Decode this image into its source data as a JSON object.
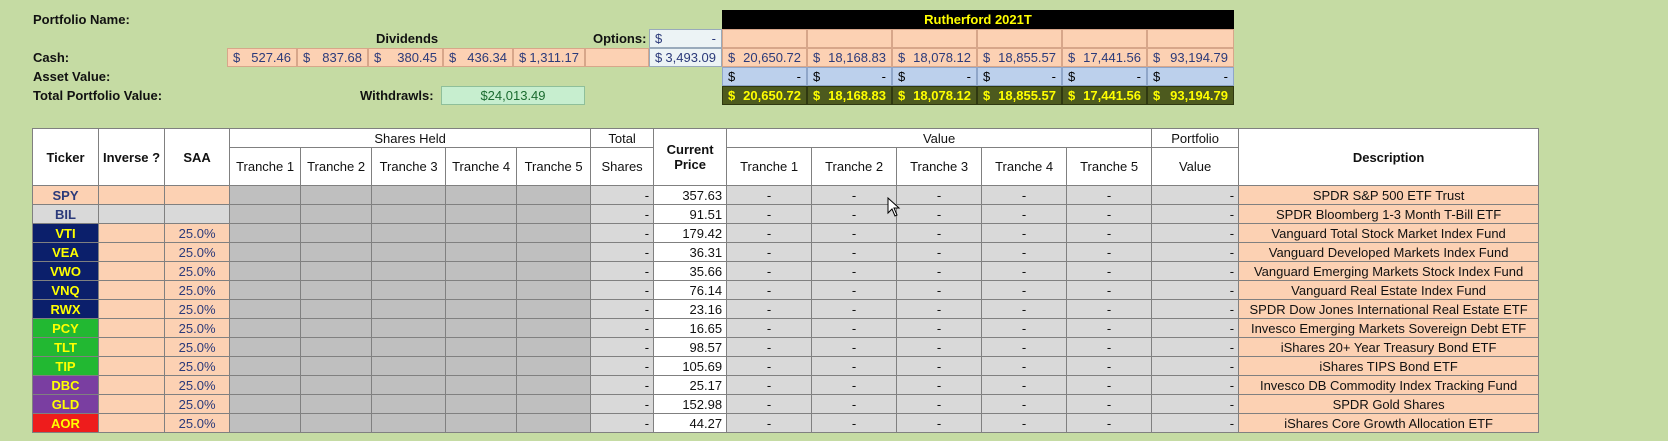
{
  "header": {
    "portfolio_name_label": "Portfolio Name:",
    "dividends_label": "Dividends",
    "options_label": "Options:",
    "cash_label": "Cash:",
    "asset_value_label": "Asset Value:",
    "total_value_label": "Total Portfolio Value:",
    "withdrawls_label": "Withdrawls:",
    "withdrawls_value": "$24,013.49",
    "dollar": "$",
    "dividends": [
      "527.46",
      "837.68",
      "380.45",
      "436.34",
      "1,311.17"
    ],
    "options_value": "-",
    "options_total": "3,493.09"
  },
  "rutherford": {
    "title": "Rutherford 2021T",
    "cash": [
      "20,650.72",
      "18,168.83",
      "18,078.12",
      "18,855.57",
      "17,441.56",
      "93,194.79"
    ],
    "asset": [
      "-",
      "-",
      "-",
      "-",
      "-",
      "-"
    ],
    "total": [
      "20,650.72",
      "18,168.83",
      "18,078.12",
      "18,855.57",
      "17,441.56",
      "93,194.79"
    ]
  },
  "table": {
    "col_ticker": "Ticker",
    "col_inverse": "Inverse ?",
    "col_saa": "SAA",
    "shares_held": "Shares Held",
    "total": "Total",
    "shares": "Shares",
    "current": "Current",
    "price": "Price",
    "value": "Value",
    "portfolio": "Portfolio",
    "portfolio_value": "Value",
    "description": "Description",
    "tranches": [
      "Tranche 1",
      "Tranche 2",
      "Tranche 3",
      "Tranche 4",
      "Tranche 5"
    ],
    "dash": "-",
    "rows": [
      {
        "ticker": "SPY",
        "bg": "#fcd1b3",
        "fg": "#2b3a7a",
        "saa": "",
        "price": "357.63",
        "desc": "SPDR S&P 500 ETF Trust"
      },
      {
        "ticker": "BIL",
        "bg": "#d9d9d9",
        "fg": "#2b3a7a",
        "saa": "",
        "price": "91.51",
        "desc": "SPDR Bloomberg 1-3 Month T-Bill ETF"
      },
      {
        "ticker": "VTI",
        "bg": "#0b1f6b",
        "fg": "#ffff00",
        "saa": "25.0%",
        "price": "179.42",
        "desc": "Vanguard Total Stock Market Index Fund"
      },
      {
        "ticker": "VEA",
        "bg": "#0b1f6b",
        "fg": "#ffff00",
        "saa": "25.0%",
        "price": "36.31",
        "desc": "Vanguard Developed Markets Index Fund"
      },
      {
        "ticker": "VWO",
        "bg": "#0b1f6b",
        "fg": "#ffff00",
        "saa": "25.0%",
        "price": "35.66",
        "desc": "Vanguard Emerging Markets Stock Index Fund"
      },
      {
        "ticker": "VNQ",
        "bg": "#0b1f6b",
        "fg": "#ffff00",
        "saa": "25.0%",
        "price": "76.14",
        "desc": "Vanguard Real Estate Index Fund"
      },
      {
        "ticker": "RWX",
        "bg": "#0b1f6b",
        "fg": "#ffff00",
        "saa": "25.0%",
        "price": "23.16",
        "desc": "SPDR Dow Jones International Real Estate ETF"
      },
      {
        "ticker": "PCY",
        "bg": "#22b832",
        "fg": "#ffff00",
        "saa": "25.0%",
        "price": "16.65",
        "desc": "Invesco Emerging Markets Sovereign Debt ETF"
      },
      {
        "ticker": "TLT",
        "bg": "#22b832",
        "fg": "#ffff00",
        "saa": "25.0%",
        "price": "98.57",
        "desc": "iShares 20+ Year Treasury Bond ETF"
      },
      {
        "ticker": "TIP",
        "bg": "#22b832",
        "fg": "#ffff00",
        "saa": "25.0%",
        "price": "105.69",
        "desc": "iShares TIPS Bond ETF"
      },
      {
        "ticker": "DBC",
        "bg": "#7a3ea1",
        "fg": "#ffff00",
        "saa": "25.0%",
        "price": "25.17",
        "desc": "Invesco DB Commodity Index Tracking Fund"
      },
      {
        "ticker": "GLD",
        "bg": "#7a3ea1",
        "fg": "#ffff00",
        "saa": "25.0%",
        "price": "152.98",
        "desc": "SPDR Gold Shares"
      },
      {
        "ticker": "AOR",
        "bg": "#ee1c1c",
        "fg": "#ffff00",
        "saa": "25.0%",
        "price": "44.27",
        "desc": "iShares Core Growth Allocation ETF"
      }
    ]
  }
}
